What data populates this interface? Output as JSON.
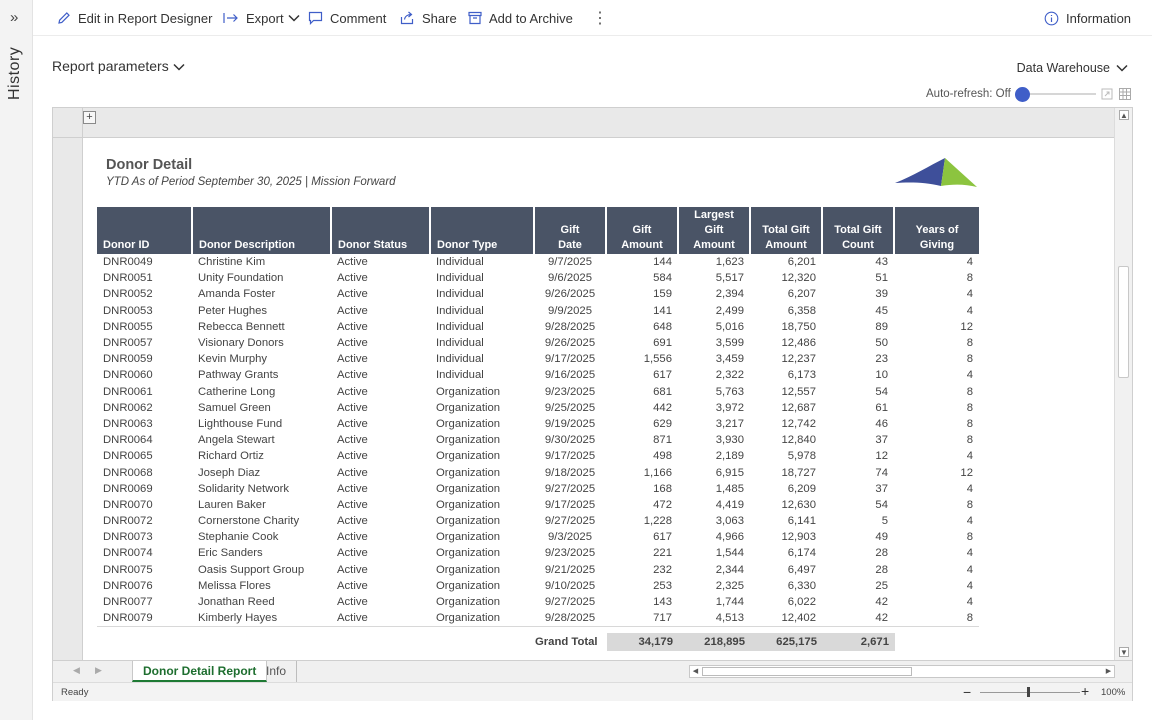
{
  "rail": {
    "label": "History",
    "toggle": "»"
  },
  "toolbar": {
    "edit": "Edit in Report Designer",
    "export": "Export",
    "comment": "Comment",
    "share": "Share",
    "archive": "Add to Archive",
    "more": "⋮",
    "information": "Information"
  },
  "params": {
    "label": "Report parameters"
  },
  "datasource": {
    "label": "Data Warehouse"
  },
  "autorefresh": {
    "label": "Auto-refresh: Off"
  },
  "report": {
    "title": "Donor Detail",
    "subtitle": "YTD As of Period September 30, 2025 | Mission Forward",
    "columns": [
      [
        "",
        "Donor ID"
      ],
      [
        "",
        "Donor Description"
      ],
      [
        "",
        "Donor Status"
      ],
      [
        "",
        "Donor Type"
      ],
      [
        "Gift",
        "Date"
      ],
      [
        "Gift",
        "Amount"
      ],
      [
        "Largest Gift",
        "Amount"
      ],
      [
        "Total Gift",
        "Amount"
      ],
      [
        "Total Gift",
        "Count"
      ],
      [
        "Years of",
        "Giving"
      ]
    ],
    "rows": [
      [
        "DNR0049",
        "Christine Kim",
        "Active",
        "Individual",
        "9/7/2025",
        "144",
        "1,623",
        "6,201",
        "43",
        "4"
      ],
      [
        "DNR0051",
        "Unity Foundation",
        "Active",
        "Individual",
        "9/6/2025",
        "584",
        "5,517",
        "12,320",
        "51",
        "8"
      ],
      [
        "DNR0052",
        "Amanda Foster",
        "Active",
        "Individual",
        "9/26/2025",
        "159",
        "2,394",
        "6,207",
        "39",
        "4"
      ],
      [
        "DNR0053",
        "Peter Hughes",
        "Active",
        "Individual",
        "9/9/2025",
        "141",
        "2,499",
        "6,358",
        "45",
        "4"
      ],
      [
        "DNR0055",
        "Rebecca Bennett",
        "Active",
        "Individual",
        "9/28/2025",
        "648",
        "5,016",
        "18,750",
        "89",
        "12"
      ],
      [
        "DNR0057",
        "Visionary Donors",
        "Active",
        "Individual",
        "9/26/2025",
        "691",
        "3,599",
        "12,486",
        "50",
        "8"
      ],
      [
        "DNR0059",
        "Kevin Murphy",
        "Active",
        "Individual",
        "9/17/2025",
        "1,556",
        "3,459",
        "12,237",
        "23",
        "8"
      ],
      [
        "DNR0060",
        "Pathway Grants",
        "Active",
        "Individual",
        "9/16/2025",
        "617",
        "2,322",
        "6,173",
        "10",
        "4"
      ],
      [
        "DNR0061",
        "Catherine Long",
        "Active",
        "Organization",
        "9/23/2025",
        "681",
        "5,763",
        "12,557",
        "54",
        "8"
      ],
      [
        "DNR0062",
        "Samuel Green",
        "Active",
        "Organization",
        "9/25/2025",
        "442",
        "3,972",
        "12,687",
        "61",
        "8"
      ],
      [
        "DNR0063",
        "Lighthouse Fund",
        "Active",
        "Organization",
        "9/19/2025",
        "629",
        "3,217",
        "12,742",
        "46",
        "8"
      ],
      [
        "DNR0064",
        "Angela Stewart",
        "Active",
        "Organization",
        "9/30/2025",
        "871",
        "3,930",
        "12,840",
        "37",
        "8"
      ],
      [
        "DNR0065",
        "Richard Ortiz",
        "Active",
        "Organization",
        "9/17/2025",
        "498",
        "2,189",
        "5,978",
        "12",
        "4"
      ],
      [
        "DNR0068",
        "Joseph Diaz",
        "Active",
        "Organization",
        "9/18/2025",
        "1,166",
        "6,915",
        "18,727",
        "74",
        "12"
      ],
      [
        "DNR0069",
        "Solidarity Network",
        "Active",
        "Organization",
        "9/27/2025",
        "168",
        "1,485",
        "6,209",
        "37",
        "4"
      ],
      [
        "DNR0070",
        "Lauren Baker",
        "Active",
        "Organization",
        "9/17/2025",
        "472",
        "4,419",
        "12,630",
        "54",
        "8"
      ],
      [
        "DNR0072",
        "Cornerstone Charity",
        "Active",
        "Organization",
        "9/27/2025",
        "1,228",
        "3,063",
        "6,141",
        "5",
        "4"
      ],
      [
        "DNR0073",
        "Stephanie Cook",
        "Active",
        "Organization",
        "9/3/2025",
        "617",
        "4,966",
        "12,903",
        "49",
        "8"
      ],
      [
        "DNR0074",
        "Eric Sanders",
        "Active",
        "Organization",
        "9/23/2025",
        "221",
        "1,544",
        "6,174",
        "28",
        "4"
      ],
      [
        "DNR0075",
        "Oasis Support Group",
        "Active",
        "Organization",
        "9/21/2025",
        "232",
        "2,344",
        "6,497",
        "28",
        "4"
      ],
      [
        "DNR0076",
        "Melissa Flores",
        "Active",
        "Organization",
        "9/10/2025",
        "253",
        "2,325",
        "6,330",
        "25",
        "4"
      ],
      [
        "DNR0077",
        "Jonathan Reed",
        "Active",
        "Organization",
        "9/27/2025",
        "143",
        "1,744",
        "6,022",
        "42",
        "4"
      ],
      [
        "DNR0079",
        "Kimberly Hayes",
        "Active",
        "Organization",
        "9/28/2025",
        "717",
        "4,513",
        "12,402",
        "42",
        "8"
      ]
    ],
    "grand_total": {
      "label": "Grand Total",
      "gift_amount": "34,179",
      "largest_gift": "218,895",
      "total_gift": "625,175",
      "total_count": "2,671"
    }
  },
  "tabs": {
    "active": "Donor Detail Report",
    "inactive": "Info"
  },
  "status": {
    "text": "Ready",
    "zoom": "100%",
    "zoom_level_percent": 100
  },
  "colors": {
    "header_bg": "#4a5466",
    "accent_blue": "#3f5ec8",
    "tab_green": "#1e6e2f",
    "logo_blue": "#3e4f9a",
    "logo_green": "#8cc43f"
  }
}
